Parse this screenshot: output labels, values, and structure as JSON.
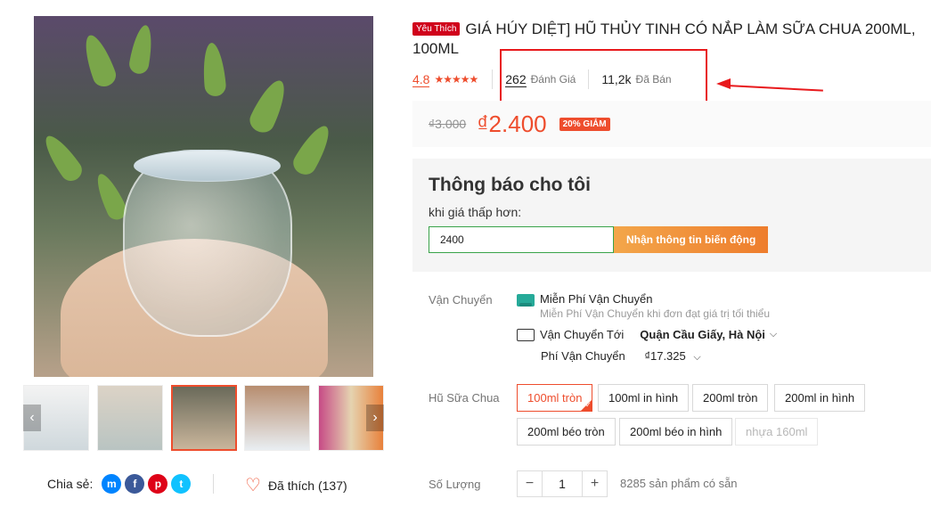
{
  "product": {
    "badge": "Yêu Thích",
    "title": "GIÁ HÚY DIỆT] HŨ THỦY TINH CÓ NẮP LÀM SỮA CHUA 200ML, 100ML"
  },
  "rating": {
    "score": "4.8",
    "stars": "★★★★★",
    "reviews_count": "262",
    "reviews_label": "Đánh Giá",
    "sold_count": "11,2k",
    "sold_label": "Đã Bán"
  },
  "price": {
    "original": "₫3.000",
    "current": "₫2.400",
    "discount": "20% GIẢM"
  },
  "notify": {
    "title": "Thông báo cho tôi",
    "subtitle": "khi giá thấp hơn:",
    "input_value": "2400",
    "button_label": "Nhận thông tin biến động"
  },
  "shipping": {
    "label": "Vận Chuyển",
    "free_title": "Miễn Phí Vận Chuyển",
    "free_desc": "Miễn Phí Vận Chuyển khi đơn đạt giá trị tối thiểu",
    "to_label": "Vận Chuyển Tới",
    "to_location": "Quận Cầu Giấy, Hà Nội",
    "fee_label": "Phí Vận Chuyển",
    "fee_value": "₫17.325"
  },
  "variants": {
    "label": "Hũ Sữa Chua",
    "options": [
      "100ml tròn",
      "100ml in hình",
      "200ml tròn",
      "200ml in hình",
      "200ml béo tròn",
      "200ml béo in hình",
      "nhựa 160ml"
    ],
    "selected": "100ml tròn",
    "disabled": "nhựa 160ml"
  },
  "quantity": {
    "label": "Số Lượng",
    "minus": "−",
    "value": "1",
    "plus": "+",
    "stock": "8285 sản phẩm có sẵn"
  },
  "share": {
    "label": "Chia sẻ:",
    "liked_label": "Đã thích (137)"
  },
  "colors": {
    "accent": "#ee4d2d",
    "annotation_red": "#e8191c",
    "notify_input_border": "#3aa34a"
  }
}
